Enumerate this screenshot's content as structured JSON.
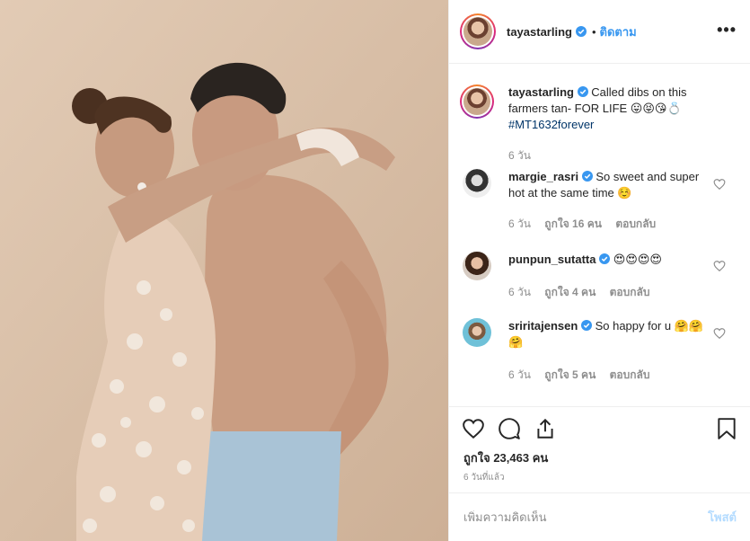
{
  "post": {
    "author": "tayastarling",
    "follow_label": "ติดตาม",
    "more_label": "•••",
    "photo_alt": "Couple portrait"
  },
  "caption": {
    "username": "tayastarling",
    "text": "Called dibs on this farmers tan- FOR LIFE 😛😝😘💍",
    "hashtag": "#MT1632forever",
    "time": "6 วัน"
  },
  "comments": [
    {
      "username": "margie_rasri",
      "text": "So sweet and super hot at the same time ☺️",
      "time": "6 วัน",
      "likes": "ถูกใจ 16 คน",
      "reply": "ตอบกลับ"
    },
    {
      "username": "punpun_sutatta",
      "text": "😍😍😍😍",
      "time": "6 วัน",
      "likes": "ถูกใจ 4 คน",
      "reply": "ตอบกลับ"
    },
    {
      "username": "sriritajensen",
      "text": "So happy for u 🤗🤗🤗",
      "time": "6 วัน",
      "likes": "ถูกใจ 5 คน",
      "reply": "ตอบกลับ"
    }
  ],
  "stats": {
    "likes": "ถูกใจ 23,463 คน",
    "posted": "6 วันที่แล้ว"
  },
  "comment_box": {
    "placeholder": "เพิ่มความคิดเห็น",
    "post_label": "โพสต์"
  },
  "colors": {
    "accent": "#3897f0",
    "verified": "#3897f0",
    "post_disabled": "#b3dbff",
    "muted": "#8e8e8e"
  },
  "icons": {
    "like": "heart-icon",
    "comment": "comment-icon",
    "share": "share-icon",
    "save": "bookmark-icon",
    "verified": "verified-badge-icon",
    "more": "more-options-icon"
  }
}
